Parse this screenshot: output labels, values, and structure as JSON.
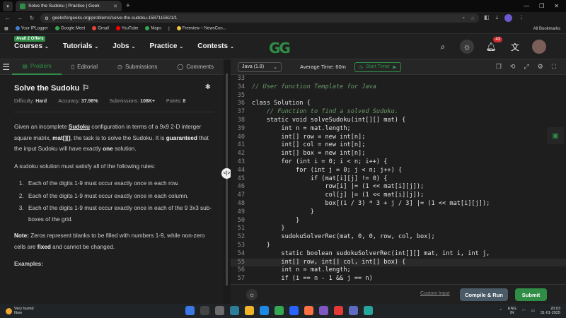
{
  "browser": {
    "tab_title": "Solve the Sudoku | Practice | Geek",
    "url": "geeksforgeeks.org/problems/solve-the-sudoku-1587115621/1",
    "bookmarks": [
      "Your IPLogger",
      "Google Meet",
      "Gmail",
      "YouTube",
      "Maps",
      "|",
      "Freeview – NewsCon..."
    ],
    "all_bookmarks": "All Bookmarks"
  },
  "header": {
    "offer": "Avail 2 Offers",
    "menu": [
      "Courses",
      "Tutorials",
      "Jobs",
      "Practice",
      "Contests"
    ],
    "logo": "GG",
    "notification_count": "43"
  },
  "left_tabs": {
    "problem": "Problem",
    "editorial": "Editorial",
    "submissions": "Submissions",
    "comments": "Comments"
  },
  "problem": {
    "title": "Solve the Sudoku",
    "difficulty_label": "Difficulty:",
    "difficulty": "Hard",
    "accuracy_label": "Accuracy:",
    "accuracy": "37.98%",
    "submissions_label": "Submissions:",
    "submissions": "108K+",
    "points_label": "Points:",
    "points": "8",
    "p1_a": "Given an incomplete ",
    "p1_link": "Sudoku",
    "p1_b": " configuration in terms of a 9x9  2-D interger square matrix, ",
    "p1_bold": "mat[][]",
    "p1_c": ", the task is to solve the Sudoku. It is ",
    "p1_bold2": "guaranteed",
    "p1_d": " that the input Sudoku will have exactly ",
    "p1_bold3": "one",
    "p1_e": " solution.",
    "p2": "A sudoku solution must satisfy all of the following rules:",
    "rules": [
      "Each of the digits 1-9 must occur exactly once in each row.",
      "Each of the digits 1-9 must occur exactly once in each column.",
      "Each of the digits 1-9 must occur exactly once in each of the 9 3x3 sub-boxes of the grid."
    ],
    "note_label": "Note:",
    "note_a": " Zeros represent blanks to be filled with numbers 1-9, while non-zero cells are ",
    "note_bold": "fixed",
    "note_b": " and cannot be changed.",
    "examples": "Examples:"
  },
  "editor": {
    "language": "Java (1.8)",
    "avg_time": "Average Time: 60m",
    "timer": "Start Timer",
    "custom_input": "Custom Input",
    "compile": "Compile & Run",
    "submit": "Submit"
  },
  "code": [
    {
      "n": "33",
      "t": ""
    },
    {
      "n": "34",
      "t": "// User function Template for Java"
    },
    {
      "n": "35",
      "t": ""
    },
    {
      "n": "36",
      "t": "class Solution {"
    },
    {
      "n": "37",
      "t": "    // Function to find a solved Sudoku."
    },
    {
      "n": "38",
      "t": "    static void solveSudoku(int[][] mat) {"
    },
    {
      "n": "39",
      "t": "        int n = mat.length;"
    },
    {
      "n": "40",
      "t": "        int[] row = new int[n];"
    },
    {
      "n": "41",
      "t": "        int[] col = new int[n];"
    },
    {
      "n": "42",
      "t": "        int[] box = new int[n];"
    },
    {
      "n": "43",
      "t": "        for (int i = 0; i < n; i++) {"
    },
    {
      "n": "44",
      "t": "            for (int j = 0; j < n; j++) {"
    },
    {
      "n": "45",
      "t": "                if (mat[i][j] != 0) {"
    },
    {
      "n": "46",
      "t": "                    row[i] |= (1 << mat[i][j]);"
    },
    {
      "n": "47",
      "t": "                    col[j] |= (1 << mat[i][j]);"
    },
    {
      "n": "48",
      "t": "                    box[(i / 3) * 3 + j / 3] |= (1 << mat[i][j]);"
    },
    {
      "n": "49",
      "t": "                }"
    },
    {
      "n": "50",
      "t": "            }"
    },
    {
      "n": "51",
      "t": "        }"
    },
    {
      "n": "52",
      "t": "        sudokuSolverRec(mat, 0, 0, row, col, box);"
    },
    {
      "n": "53",
      "t": "    }"
    },
    {
      "n": "54",
      "t": "        static boolean sudokuSolverRec(int[][] mat, int i, int j,"
    },
    {
      "n": "55",
      "t": "        int[] row, int[] col, int[] box) {"
    },
    {
      "n": "56",
      "t": "        int n = mat.length;"
    },
    {
      "n": "57",
      "t": "        if (i == n - 1 && j == n)"
    }
  ],
  "taskbar": {
    "weather1": "Very humid",
    "weather2": "Now",
    "lang1": "ENG",
    "lang2": "IN",
    "time": "20:03",
    "date": "31-01-2025"
  }
}
